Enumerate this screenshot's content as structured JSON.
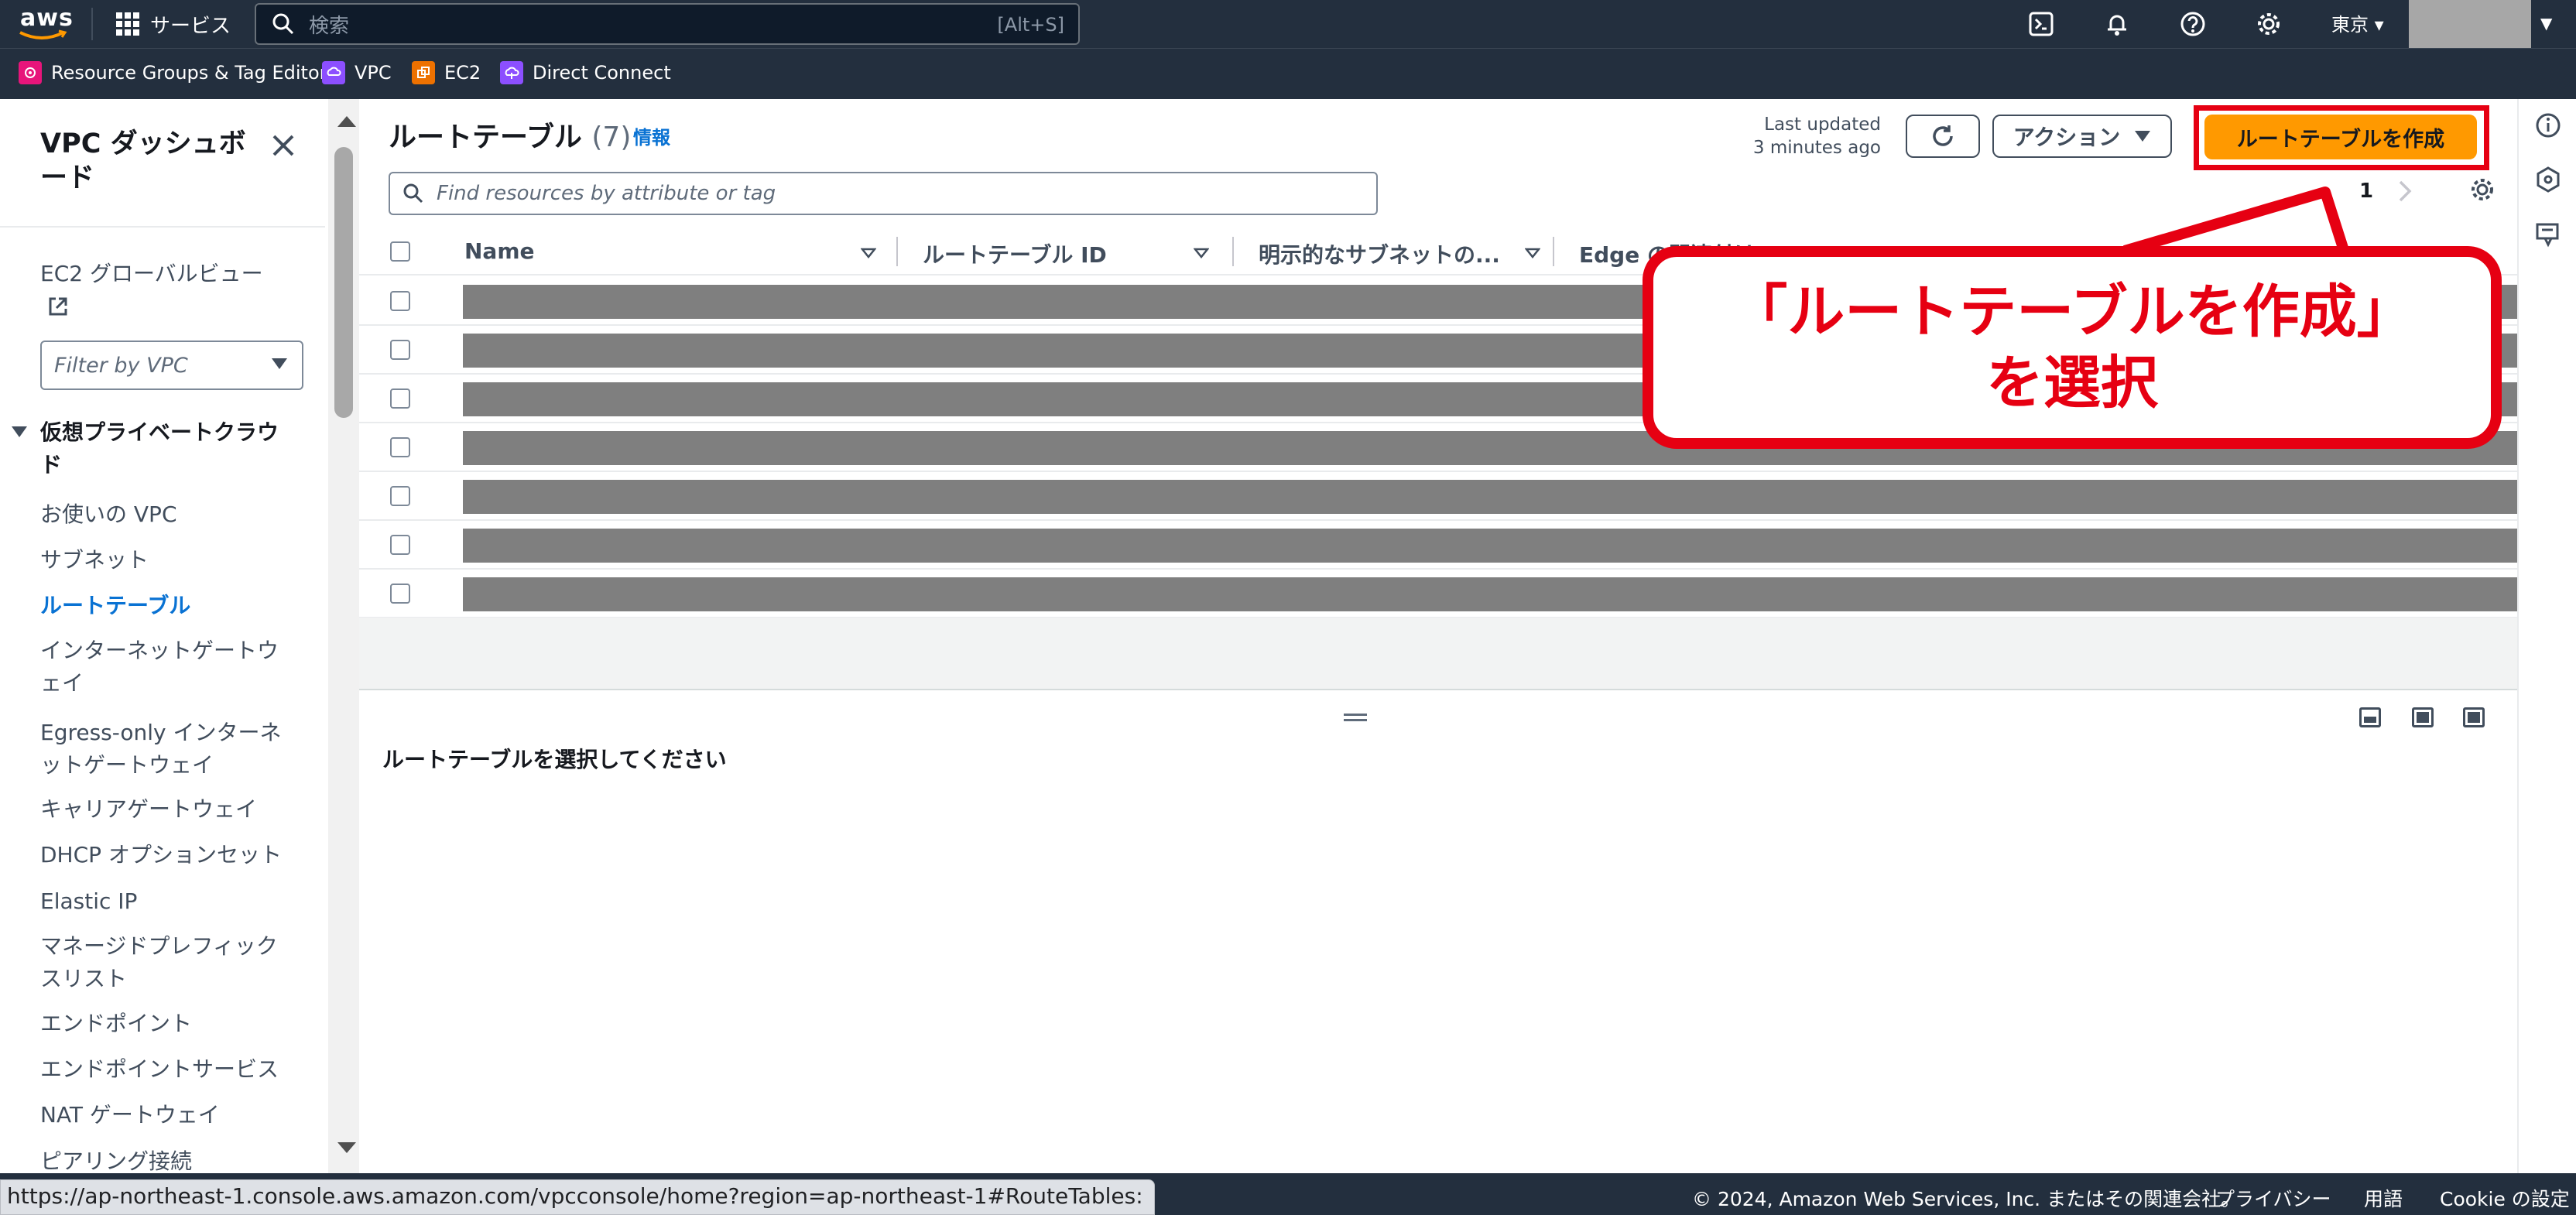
{
  "topnav": {
    "logo_text": "aws",
    "services_label": "サービス",
    "search_placeholder": "検索",
    "search_shortcut": "[Alt+S]",
    "region": "東京 ▾"
  },
  "favorites": [
    {
      "label": "Resource Groups & Tag Editor",
      "color": "#e7157b",
      "icon": "resource-groups-icon"
    },
    {
      "label": "VPC",
      "color": "#8c4fff",
      "icon": "vpc-icon"
    },
    {
      "label": "EC2",
      "color": "#ed7100",
      "icon": "ec2-icon"
    },
    {
      "label": "Direct Connect",
      "color": "#8c4fff",
      "icon": "direct-connect-icon"
    }
  ],
  "sidebar": {
    "title": "VPC ダッシュボード",
    "ec2_global_view": "EC2 グローバルビュー",
    "filter_placeholder": "Filter by VPC",
    "section": "仮想プライベートクラウド",
    "items": [
      {
        "label": "お使いの VPC",
        "active": false
      },
      {
        "label": "サブネット",
        "active": false
      },
      {
        "label": "ルートテーブル",
        "active": true
      },
      {
        "label": "インターネットゲートウェイ",
        "active": false
      },
      {
        "label": "Egress-only インターネットゲートウェイ",
        "active": false
      },
      {
        "label": "キャリアゲートウェイ",
        "active": false
      },
      {
        "label": "DHCP オプションセット",
        "active": false
      },
      {
        "label": "Elastic IP",
        "active": false
      },
      {
        "label": "マネージドプレフィックスリスト",
        "active": false
      },
      {
        "label": "エンドポイント",
        "active": false
      },
      {
        "label": "エンドポイントサービス",
        "active": false
      },
      {
        "label": "NAT ゲートウェイ",
        "active": false
      },
      {
        "label": "ピアリング接続",
        "active": false
      }
    ]
  },
  "main": {
    "title": "ルートテーブル",
    "count": "(7)",
    "info_link": "情報",
    "last_updated_line1": "Last updated",
    "last_updated_line2": "3 minutes ago",
    "actions_label": "アクション",
    "create_label": "ルートテーブルを作成",
    "filter_placeholder": "Find resources by attribute or tag",
    "page_number": "1",
    "columns": [
      "Name",
      "ルートテーブル ID",
      "明示的なサブネットの...",
      "Edge の関連付け"
    ],
    "row_count": 7,
    "detail_message": "ルートテーブルを選択してください"
  },
  "callout": {
    "line1": "「ルートテーブルを作成」",
    "line2": "を選択",
    "color": "#e60012"
  },
  "footer": {
    "copyright": "© 2024, Amazon Web Services, Inc. またはその関連会社。",
    "privacy": "プライバシー",
    "terms": "用語",
    "cookie": "Cookie の設定"
  },
  "status_url": "https://ap-northeast-1.console.aws.amazon.com/vpcconsole/home?region=ap-northeast-1#RouteTables:",
  "colors": {
    "nav_bg": "#232f3e",
    "primary_button": "#ff9900",
    "link": "#0972d3",
    "highlight": "#e60012"
  }
}
